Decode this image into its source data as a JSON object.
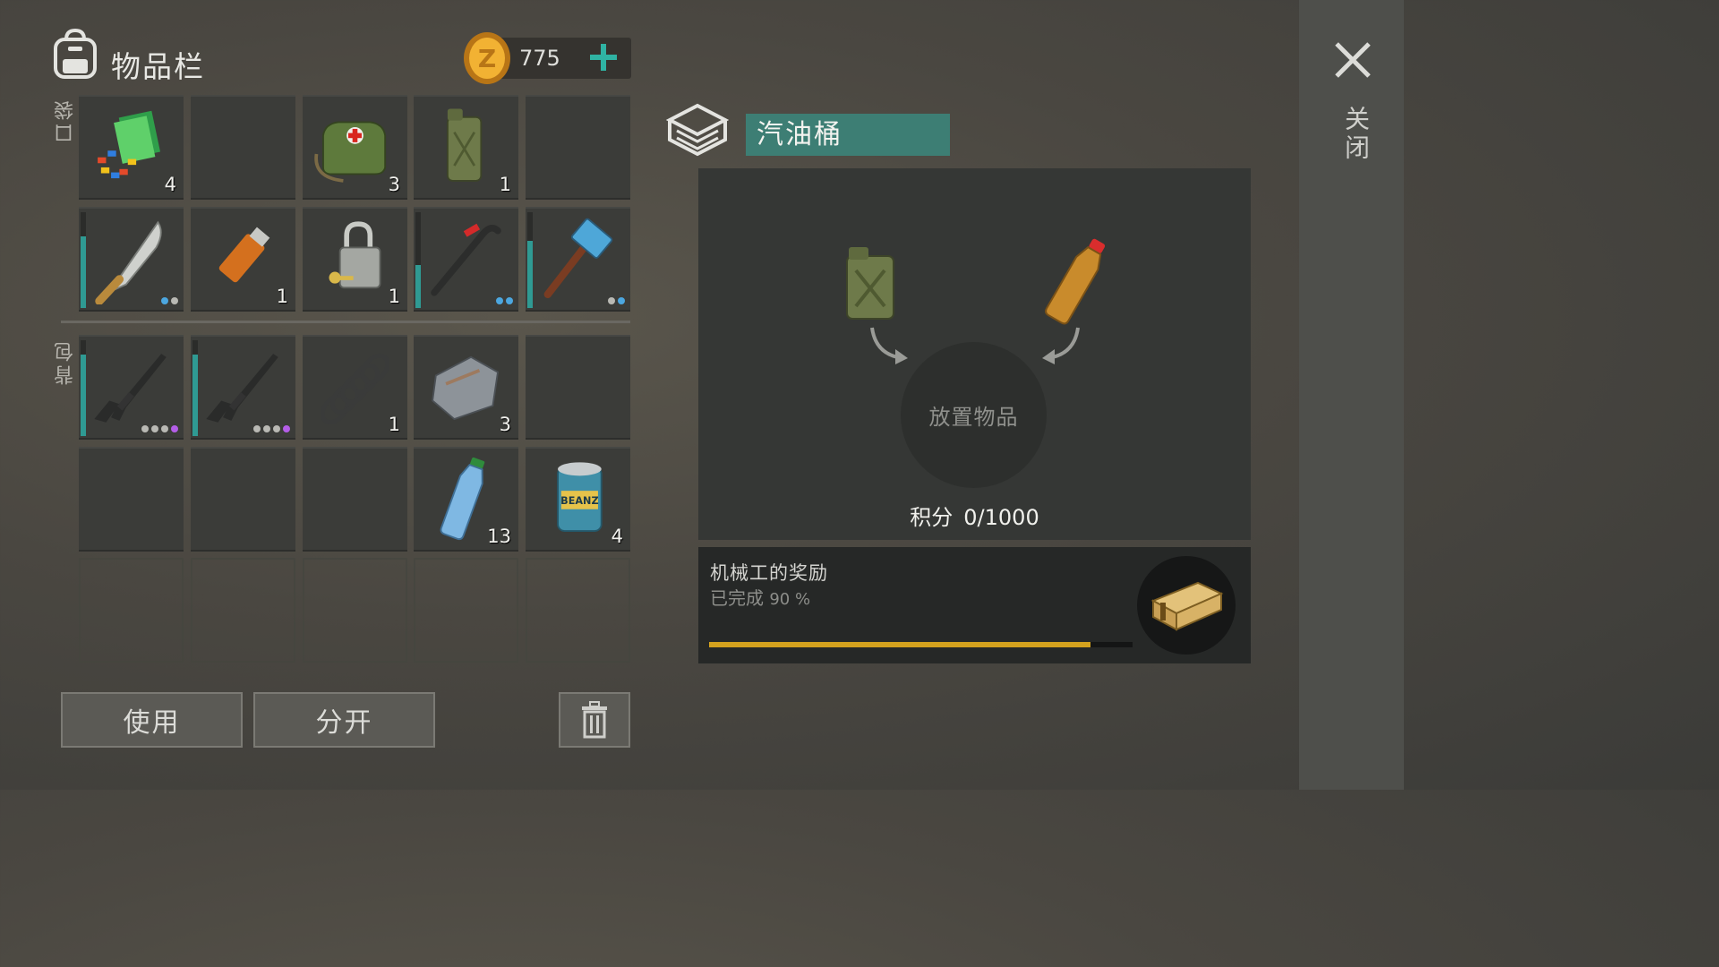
{
  "header": {
    "title": "物品栏",
    "coins": "775"
  },
  "sections": {
    "pocket": "口袋",
    "backpack": "背包"
  },
  "inventory": {
    "pocket": [
      {
        "icon": "building-materials-icon",
        "count": "4"
      },
      {
        "icon": "",
        "count": ""
      },
      {
        "icon": "medical-bag-icon",
        "count": "3"
      },
      {
        "icon": "jerrycan-icon",
        "count": "1"
      },
      {
        "icon": "",
        "count": ""
      },
      {
        "icon": "machete-icon",
        "count": "",
        "durability": 0.75,
        "dots": [
          "b",
          "g"
        ]
      },
      {
        "icon": "lighter-icon",
        "count": "1"
      },
      {
        "icon": "padlock-icon",
        "count": "1"
      },
      {
        "icon": "crowbar-icon",
        "count": "",
        "durability": 0.45,
        "dots": [
          "b",
          "b"
        ]
      },
      {
        "icon": "sledgehammer-icon",
        "count": "",
        "durability": 0.7,
        "dots": [
          "g",
          "b"
        ]
      }
    ],
    "backpack": [
      {
        "icon": "assault-rifle-icon",
        "count": "",
        "durability": 0.85,
        "dots": [
          "g",
          "g",
          "g",
          "p"
        ]
      },
      {
        "icon": "assault-rifle-icon",
        "count": "",
        "durability": 0.85,
        "dots": [
          "g",
          "g",
          "g",
          "p"
        ]
      },
      {
        "icon": "spring-icon",
        "count": "1"
      },
      {
        "icon": "metal-plate-icon",
        "count": "3"
      },
      {
        "icon": "",
        "count": ""
      },
      {
        "icon": "",
        "count": ""
      },
      {
        "icon": "",
        "count": ""
      },
      {
        "icon": "",
        "count": ""
      },
      {
        "icon": "water-bottle-icon",
        "count": "13"
      },
      {
        "icon": "bean-can-icon",
        "count": "4"
      }
    ]
  },
  "buttons": {
    "use": "使用",
    "split": "分开"
  },
  "detail": {
    "title": "汽油桶",
    "drop_label": "放置物品",
    "score_label": "积分",
    "score_value": "0/1000"
  },
  "reward": {
    "title": "机械工的奖励",
    "status": "已完成",
    "percent": "90 %",
    "progress": 0.9
  },
  "close_label": "关闭",
  "colors": {
    "accent_teal": "#3d7e74",
    "progress_gold": "#d4a21e",
    "durability": "#2f9a93"
  }
}
